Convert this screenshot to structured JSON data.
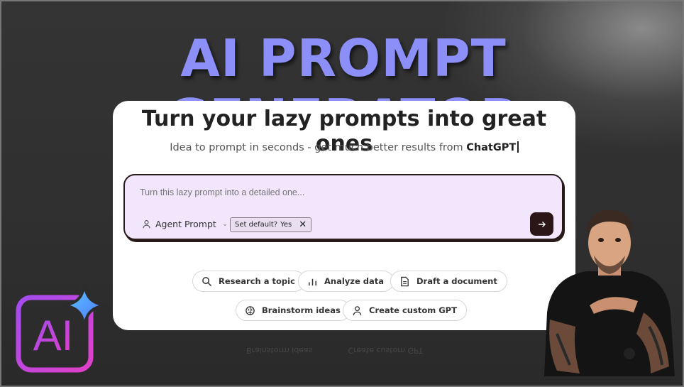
{
  "headline": "AI PROMPT GENERATOR",
  "card": {
    "title": "Turn your lazy prompts into great ones",
    "subtitle_prefix": "Idea to prompt in seconds - get much better results from",
    "subtitle_brand": "ChatGPT"
  },
  "prompt": {
    "placeholder": "Turn this lazy prompt into a detailed one...",
    "agent_label": "Agent Prompt",
    "default_label": "Set default?",
    "default_value": "Yes",
    "send_icon": "arrow-right-icon"
  },
  "chips": [
    {
      "label": "Research a topic",
      "icon": "search-icon"
    },
    {
      "label": "Analyze data",
      "icon": "bar-chart-icon"
    },
    {
      "label": "Draft a document",
      "icon": "document-icon"
    },
    {
      "label": "Brainstorm ideas",
      "icon": "brain-icon"
    },
    {
      "label": "Create custom GPT",
      "icon": "person-icon"
    }
  ],
  "logo": {
    "text": "AI"
  },
  "colors": {
    "headline": "#8b8ff7",
    "prompt_bg": "#f1e6fc",
    "send_bg": "#2a1616",
    "logo_gradient_start": "#b04ff0",
    "logo_gradient_end": "#6a7cff"
  }
}
